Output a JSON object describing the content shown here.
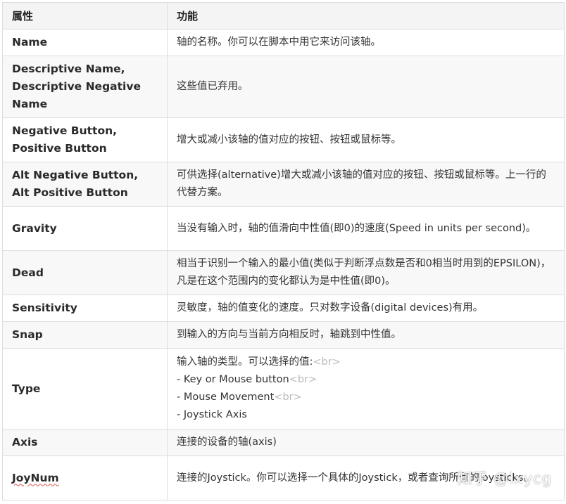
{
  "table": {
    "headers": [
      "属性",
      "功能"
    ],
    "rows": [
      {
        "property": "Name",
        "function": [
          "轴的名称。你可以在脚本中用它来访问该轴。"
        ]
      },
      {
        "property": "Descriptive Name, Descriptive Negative Name",
        "function": [
          "这些值已弃用。"
        ]
      },
      {
        "property": "Negative Button, Positive Button",
        "function": [
          "增大或减小该轴的值对应的按钮、按钮或鼠标等。"
        ]
      },
      {
        "property": "Alt Negative Button, Alt Positive Button",
        "function": [
          "可供选择(alternative)增大或减小该轴的值对应的按钮、按钮或鼠标等。上一行的代替方案。"
        ]
      },
      {
        "property": "Gravity",
        "function": [
          "当没有输入时，轴的值滑向中性值(即0)的速度(Speed in units per second)。"
        ]
      },
      {
        "property": "Dead",
        "function": [
          "相当于识别一个输入的最小值(类似于判断浮点数是否和0相当时用到的EPSILON)，凡是在这个范围内的变化都认为是中性值(即0)。"
        ]
      },
      {
        "property": "Sensitivity",
        "function": [
          "灵敏度，轴的值变化的速度。只对数字设备(digital devices)有用。"
        ]
      },
      {
        "property": "Snap",
        "function": [
          "到输入的方向与当前方向相反时，轴跳到中性值。"
        ]
      },
      {
        "property": "Type",
        "function": [
          "输入轴的类型。可以选择的值:",
          " - Key or Mouse button",
          " - Mouse Movement",
          " - Joystick Axis"
        ],
        "br_tag": "<br>"
      },
      {
        "property": "Axis",
        "function": [
          "连接的设备的轴(axis)"
        ]
      },
      {
        "property": "JoyNum",
        "function": [
          "连接的Joystick。你可以选择一个具体的Joystick，或者查询所有的joysticks。"
        ]
      }
    ]
  },
  "watermark": "知乎 @lxycg"
}
